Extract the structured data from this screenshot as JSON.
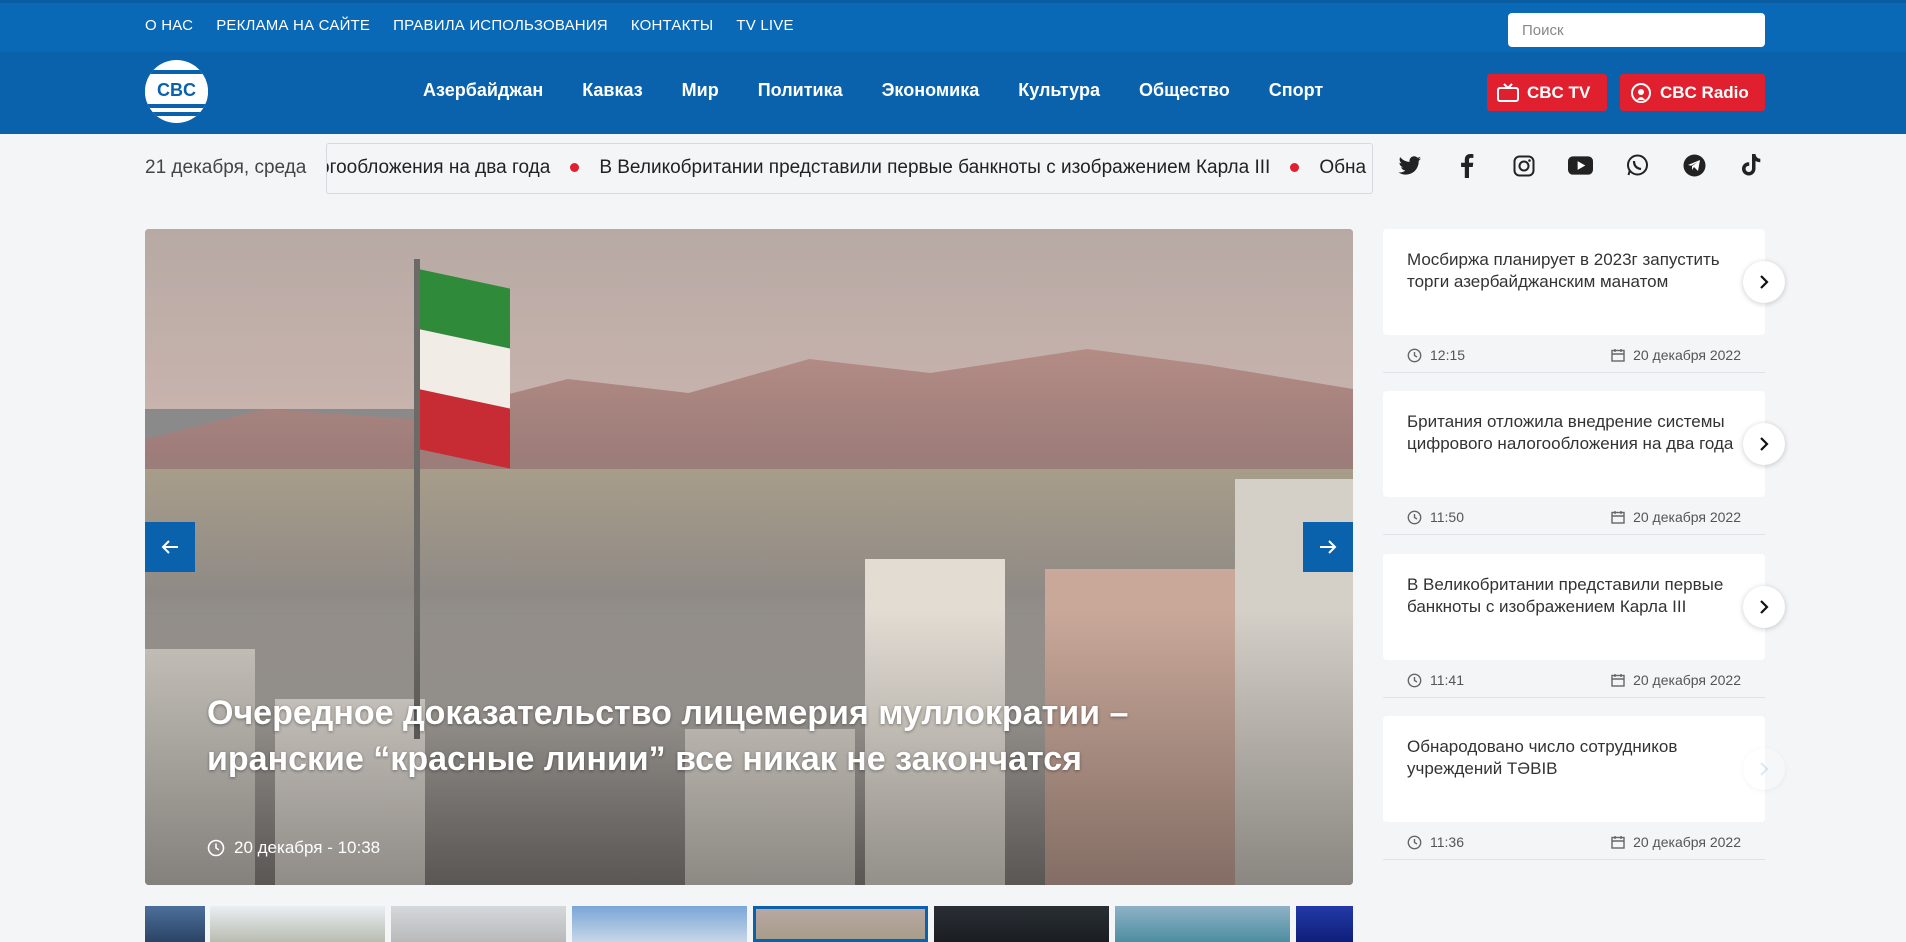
{
  "top_links": [
    "О НАС",
    "РЕКЛАМА НА САЙТЕ",
    "ПРАВИЛА ИСПОЛЬЗОВАНИЯ",
    "КОНТАКТЫ",
    "TV LIVE"
  ],
  "search": {
    "placeholder": "Поиск"
  },
  "logo": {
    "text": "CBC"
  },
  "nav": [
    "Азербайджан",
    "Кавказ",
    "Мир",
    "Политика",
    "Экономика",
    "Культура",
    "Общество",
    "Спорт"
  ],
  "buttons": {
    "tv": "CBC TV",
    "radio": "CBC Radio"
  },
  "date": "21 декабря, среда",
  "ticker": [
    "огообложения на два года",
    "В Великобритании представили первые банкноты с изображением Карла III",
    "Обна"
  ],
  "social": [
    "twitter-icon",
    "facebook-icon",
    "instagram-icon",
    "youtube-icon",
    "whatsapp-icon",
    "telegram-icon",
    "tiktok-icon"
  ],
  "hero": {
    "title": "Очередное доказательство лицемерия муллократии – иранские “красные линии” все никак не закончатся",
    "date": "20 декабря - 10:38"
  },
  "sidebar": [
    {
      "title": "Мосбиржа планирует в 2023г запустить торги азербайджанским манатом",
      "time": "12:15",
      "date": "20 декабря 2022"
    },
    {
      "title": "Британия отложила внедрение системы цифрового налогообложения на два года",
      "time": "11:50",
      "date": "20 декабря 2022"
    },
    {
      "title": "В Великобритании представили первые банкноты с изображением Карла III",
      "time": "11:41",
      "date": "20 декабря 2022"
    },
    {
      "title": "Обнародовано число сотрудников учреждений ТӘВІВ",
      "time": "11:36",
      "date": "20 декабря 2022"
    }
  ],
  "colors": {
    "primary": "#0969b7",
    "nav": "#0a62ad",
    "accent": "#e0202e"
  }
}
